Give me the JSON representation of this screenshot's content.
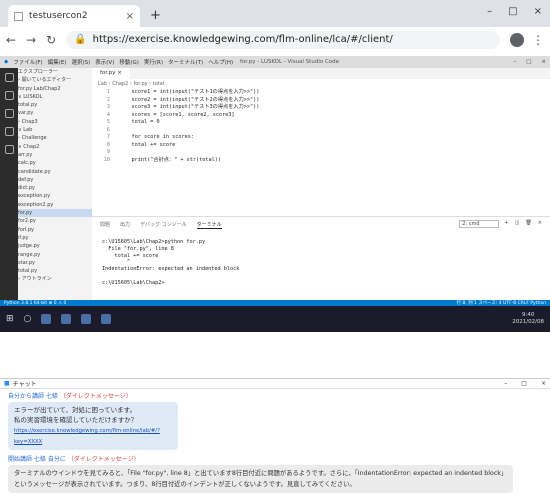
{
  "browser": {
    "tab_title": "testusercon2",
    "tab_close": "×",
    "new_tab": "+",
    "url": "https://exercise.knowledgewing.com/flm-online/lca/#/client/",
    "win": [
      "–",
      "□",
      "×"
    ]
  },
  "vscode": {
    "menu": [
      "ファイル(F)",
      "編集(E)",
      "選択(S)",
      "表示(V)",
      "移動(G)",
      "実行(R)",
      "ターミナル(T)",
      "ヘルプ(H)"
    ],
    "window_title": "for.py - LUSKOL - Visual Studio Code",
    "sidebar": [
      "エクスプローラー",
      "› 開いているエディター",
      "  for.py  Lab/Chap2",
      "∨ LUSKOL",
      "  total.py",
      "  var.py",
      "  › Chap3",
      "∨ Lab",
      "  › Challenge",
      "  ∨ Chap2",
      "    arr.py",
      "    calc.py",
      "    candidate.py",
      "    def.py",
      "    dict.py",
      "    exception.py",
      "    exception2.py",
      "    for.py",
      "    for2.py",
      "    forl.py",
      "    if.py",
      "    judge.py",
      "    range.py",
      "    star.py",
      "    total.py",
      "› アウトライン"
    ],
    "sidebar_selected": 17,
    "editor_tab": "for.py  ×",
    "breadcrumb": "Lab › Chap2 › for.py › total",
    "code": [
      {
        "n": "1",
        "t": "    score1 = int(input(\"テスト1の得点を入力>>\"))"
      },
      {
        "n": "2",
        "t": "    score2 = int(input(\"テスト2の得点を入力>>\"))"
      },
      {
        "n": "3",
        "t": "    score3 = int(input(\"テスト3の得点を入力>>\"))"
      },
      {
        "n": "4",
        "t": "    scores = [score1, score2, score3]"
      },
      {
        "n": "5",
        "t": "    total = 0"
      },
      {
        "n": "6",
        "t": ""
      },
      {
        "n": "7",
        "t": "    for score in scores:"
      },
      {
        "n": "8",
        "t": "    total += score"
      },
      {
        "n": "9",
        "t": ""
      },
      {
        "n": "10",
        "t": "    print(\"合計点：\" + str(total))"
      }
    ],
    "panel_tabs": [
      "問題",
      "出力",
      "デバッグ コンソール",
      "ターミナル"
    ],
    "panel_select": "2: cmd",
    "terminal": [
      "c:\\U15605\\Lab\\Chap2>python for.py",
      "  File \"for.py\", line 8",
      "    total += score",
      "        ^",
      "IndentationError: expected an indented block",
      "",
      "c:\\U15605\\Lab\\Chap2>"
    ],
    "status_left": "Python 3.8.1 64-bit  ⊗ 0 ⚠ 0",
    "status_right": "行 8, 列 1  スペース: 4  UTF-8  CRLF  Python"
  },
  "taskbar": {
    "time": "9:40",
    "date": "2021/02/08"
  },
  "chat": {
    "title": "チャット",
    "win": [
      "–",
      "□",
      "×"
    ],
    "msg1": {
      "sender": "自分から講師 七條",
      "tag": "（ダイレクトメッセージ）",
      "line1": "エラーが出ていて、対処に困っています。",
      "line2": "私の実習環境を確認していただけますか？",
      "link": "https://exercise.knowledgewing.com/flm-online/lab/#/?key=XXXX"
    },
    "msg2": {
      "sender": "開始講師 七條 自分に",
      "tag": "（ダイレクトメッセージ）",
      "text": "ターミナルのウインドウを見てみると、「File \"for.py\", line 8」と出ています8行目付近に問題があるようです。さらに、「IndentationError: expected an indented block」というメッセージが表示されています。つまり、8行目付近のインデントが正しくないようです。見直してみてください。"
    }
  }
}
